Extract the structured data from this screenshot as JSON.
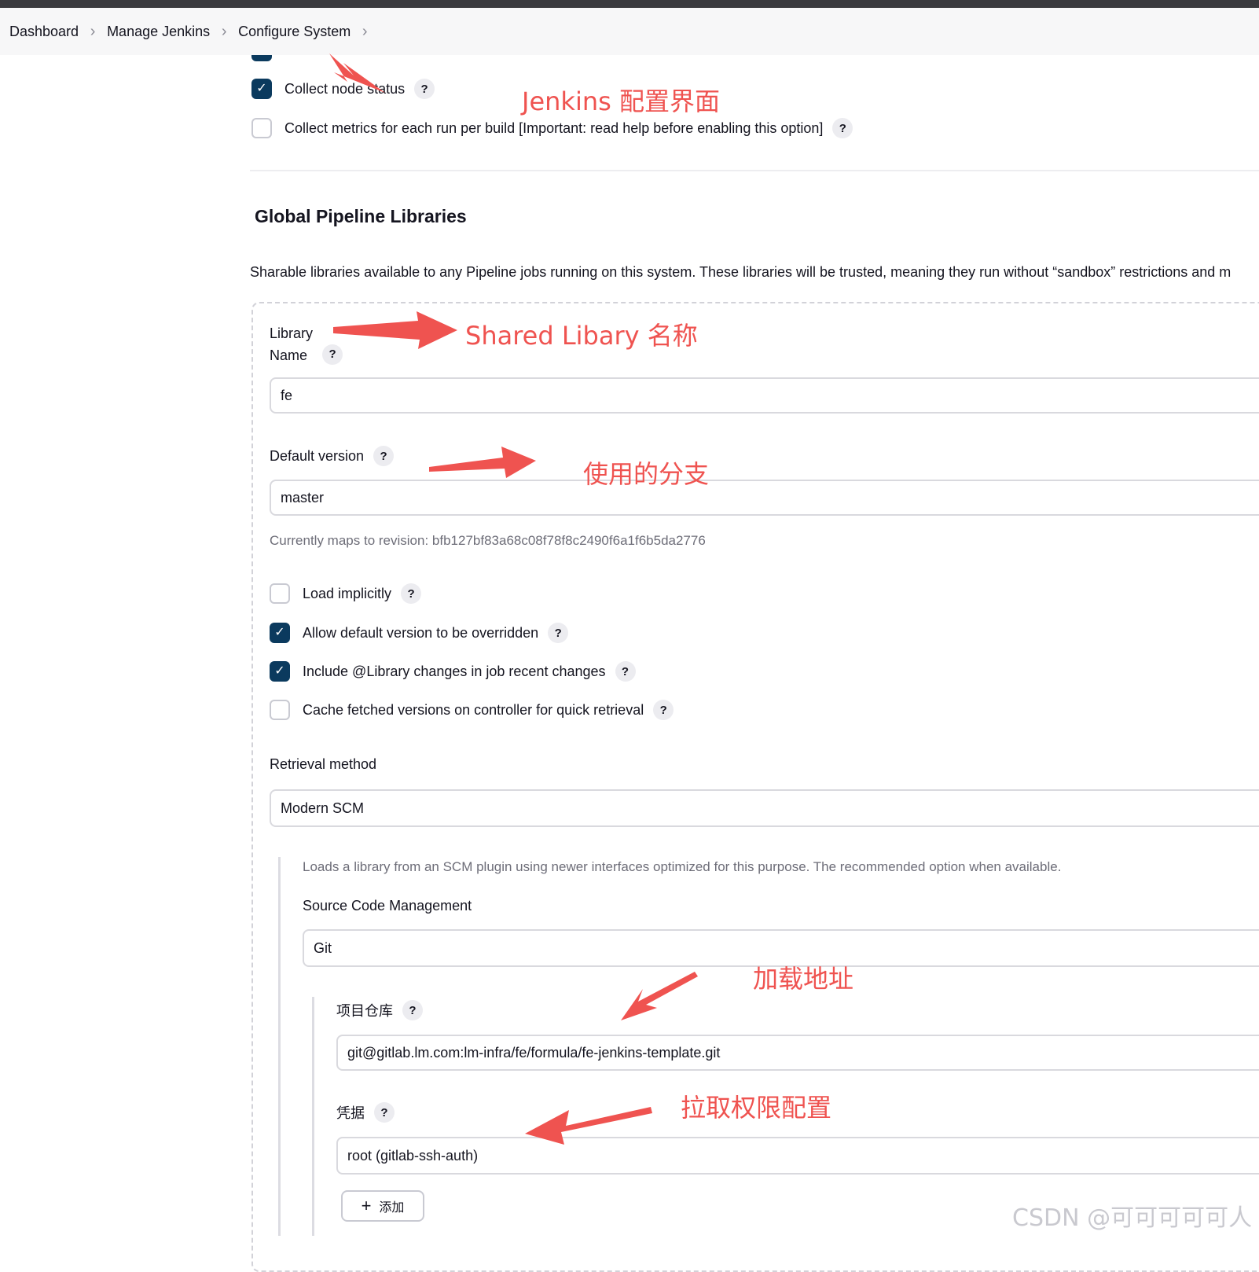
{
  "breadcrumb": {
    "items": [
      "Dashboard",
      "Manage Jenkins",
      "Configure System"
    ]
  },
  "top_options": [
    {
      "label": "Collect node status",
      "checked": true
    },
    {
      "label": "Collect metrics for each run per build [Important: read help before enabling this option]",
      "checked": false
    }
  ],
  "section": {
    "title": "Global Pipeline Libraries",
    "description": "Sharable libraries available to any Pipeline jobs running on this system. These libraries will be trusted, meaning they run without “sandbox” restrictions and m"
  },
  "library": {
    "name_label_line1": "Library",
    "name_label_line2": "Name",
    "name_value": "fe",
    "default_version_label": "Default version",
    "default_version_value": "master",
    "revision_note": "Currently maps to revision: bfb127bf83a68c08f78f8c2490f6a1f6b5da2776",
    "options": [
      {
        "label": "Load implicitly",
        "checked": false
      },
      {
        "label": "Allow default version to be overridden",
        "checked": true
      },
      {
        "label": "Include @Library changes in job recent changes",
        "checked": true
      },
      {
        "label": "Cache fetched versions on controller for quick retrieval",
        "checked": false
      }
    ],
    "retrieval_label": "Retrieval method",
    "retrieval_value": "Modern SCM",
    "retrieval_note": "Loads a library from an SCM plugin using newer interfaces optimized for this purpose. The recommended option when available.",
    "scm_label": "Source Code Management",
    "scm_value": "Git",
    "repo_label": "项目仓库",
    "repo_value": "git@gitlab.lm.com:lm-infra/fe/formula/fe-jenkins-template.git",
    "cred_label": "凭据",
    "cred_value": "root (gitlab-ssh-auth)",
    "add_label": "添加",
    "help": "?",
    "check_mark": "✓",
    "plus": "+"
  },
  "annotations": {
    "config_page": "Jenkins 配置界面",
    "library_name": "Shared Libary 名称",
    "branch": "使用的分支",
    "load_address": "加载地址",
    "pull_permission": "拉取权限配置",
    "color": "#ef5350"
  },
  "watermark": "CSDN @可可可可可人"
}
